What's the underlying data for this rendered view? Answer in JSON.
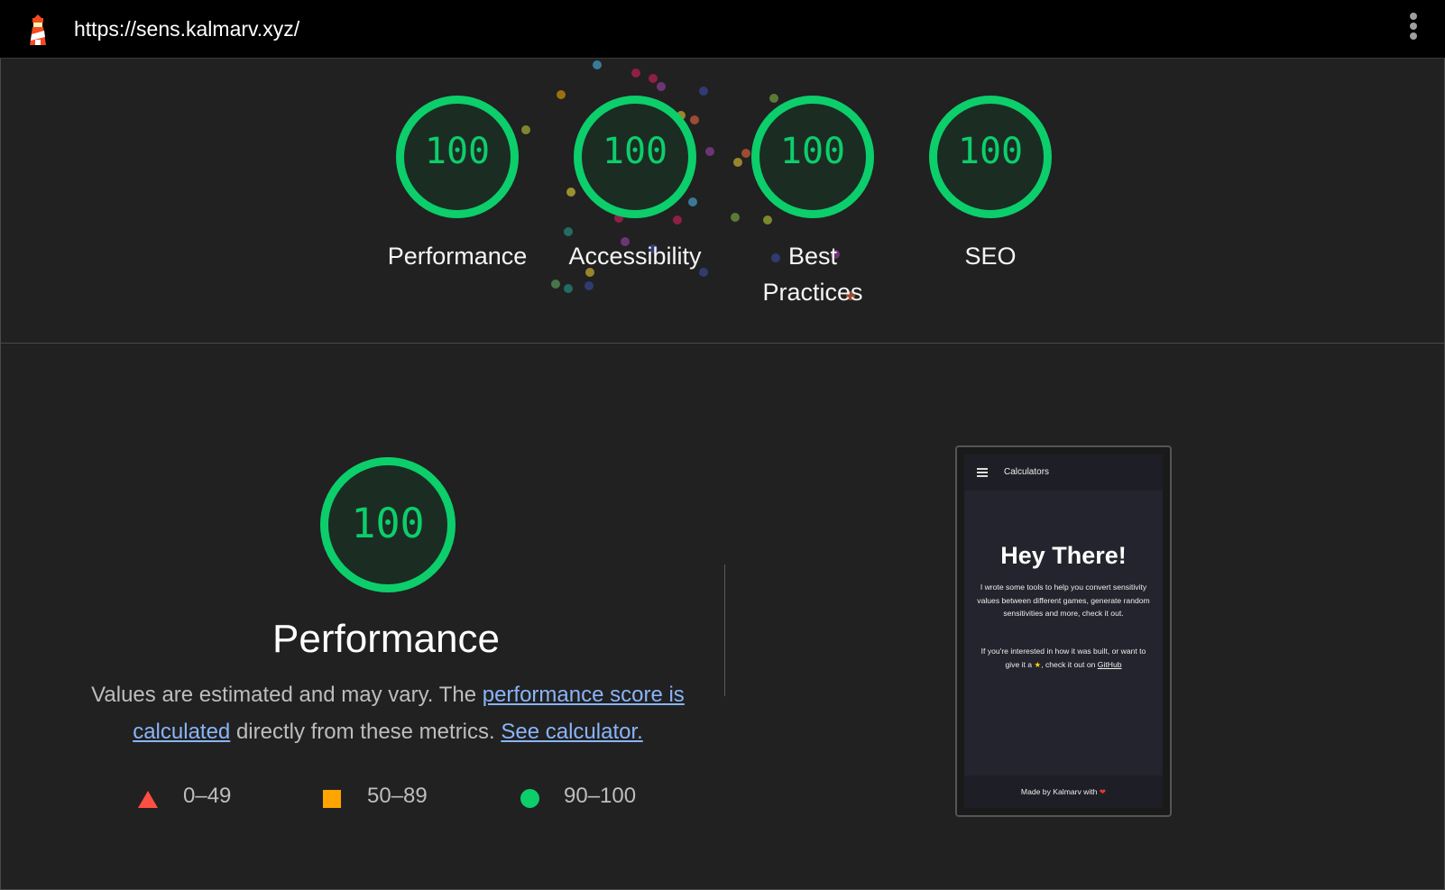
{
  "header": {
    "url": "https://sens.kalmarv.xyz/",
    "logo_icon": "lighthouse-icon",
    "menu_icon": "kebab-menu-icon"
  },
  "gauges": [
    {
      "score": "100",
      "label": "Performance"
    },
    {
      "score": "100",
      "label": "Accessibility"
    },
    {
      "score": "100",
      "label": "Best Practices"
    },
    {
      "score": "100",
      "label": "SEO"
    }
  ],
  "performance": {
    "score": "100",
    "title": "Performance",
    "desc_prefix": "Values are estimated and may vary. The ",
    "link_score": "performance score is calculated",
    "desc_middle": " directly from these metrics. ",
    "link_calc": "See calculator.",
    "legend": {
      "fail": "0–49",
      "average": "50–89",
      "pass": "90–100"
    }
  },
  "screenshot": {
    "nav_title": "Calculators",
    "heading": "Hey There!",
    "para1": "I wrote some tools to help you convert sensitivity values between different games, generate random sensitivities and more, check it out.",
    "para2_prefix": "If you're interested in how it was built, or want to give it a",
    "para2_suffix": ", check it out on",
    "github_link": "GitHub",
    "footer": "Made by Kalmarv with"
  },
  "colors": {
    "pass": "#0cce6b",
    "average": "#ffa400",
    "fail": "#ff4e42",
    "link": "#8ab4f8"
  }
}
